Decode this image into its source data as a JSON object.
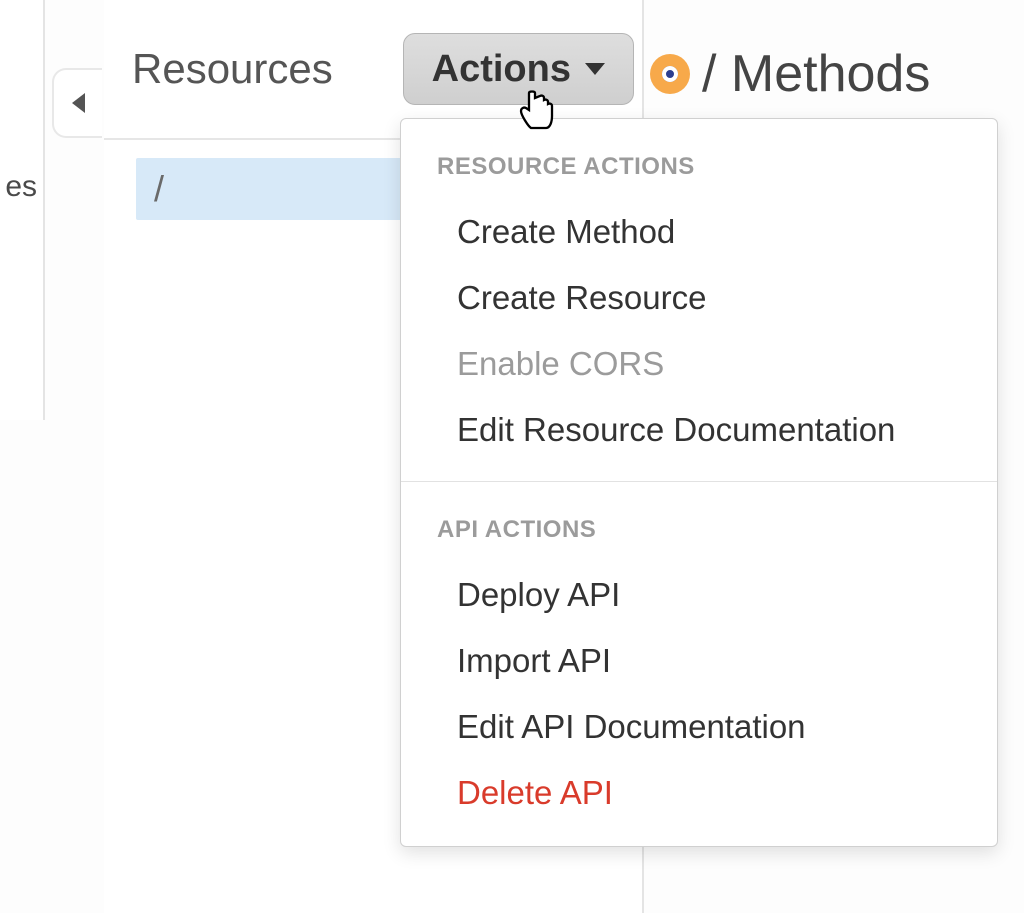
{
  "sidebar_fragment": "es",
  "resources": {
    "title": "Resources",
    "selected_path": "/"
  },
  "actions_button": {
    "label": "Actions"
  },
  "breadcrumb": {
    "path": "/",
    "section": "Methods",
    "combined": "/ Methods"
  },
  "dropdown": {
    "section1_header": "RESOURCE ACTIONS",
    "section2_header": "API ACTIONS",
    "items": {
      "create_method": "Create Method",
      "create_resource": "Create Resource",
      "enable_cors": "Enable CORS",
      "edit_resource_doc": "Edit Resource Documentation",
      "deploy_api": "Deploy API",
      "import_api": "Import API",
      "edit_api_doc": "Edit API Documentation",
      "delete_api": "Delete API"
    }
  }
}
